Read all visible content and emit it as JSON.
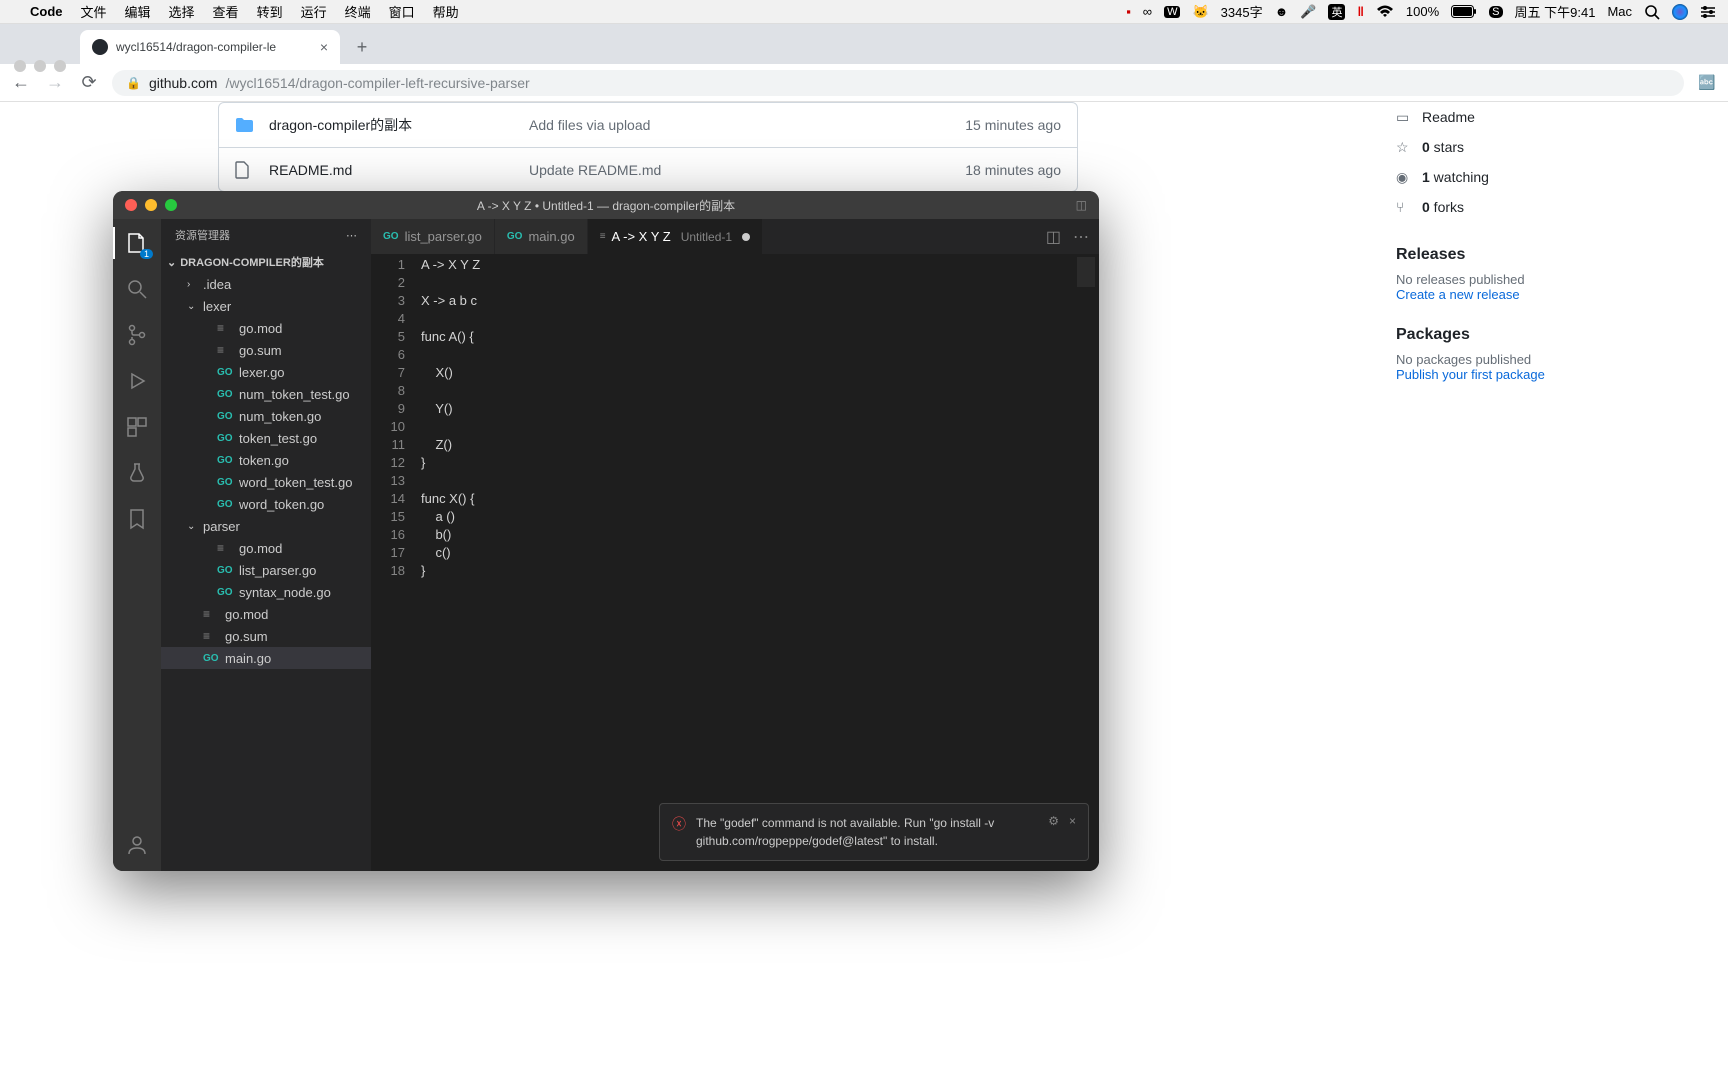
{
  "menubar": {
    "app": "Code",
    "items": [
      "文件",
      "编辑",
      "选择",
      "查看",
      "转到",
      "运行",
      "终端",
      "窗口",
      "帮助"
    ],
    "right": {
      "word_count": "3345字",
      "ime": "英",
      "battery": "100%",
      "clock": "周五 下午9:41",
      "user": "Mac"
    }
  },
  "chrome": {
    "tab_title": "wycl16514/dragon-compiler-le",
    "url_host": "github.com",
    "url_path": "/wycl16514/dragon-compiler-left-recursive-parser"
  },
  "github": {
    "files": [
      {
        "icon": "folder",
        "name": "dragon-compiler的副本",
        "msg": "Add files via upload",
        "time": "15 minutes ago"
      },
      {
        "icon": "file",
        "name": "README.md",
        "msg": "Update README.md",
        "time": "18 minutes ago"
      }
    ],
    "side": {
      "readme": "Readme",
      "stars": "0 stars",
      "watching": "1 watching",
      "forks": "0 forks",
      "releases_h": "Releases",
      "releases_txt": "No releases published",
      "releases_link": "Create a new release",
      "packages_h": "Packages",
      "packages_txt": "No packages published",
      "packages_link": "Publish your first package"
    }
  },
  "vscode": {
    "title": "A -> X Y Z • Untitled-1 — dragon-compiler的副本",
    "explorer_label": "资源管理器",
    "root": "DRAGON-COMPILER的副本",
    "activity_badge": "1",
    "tree": [
      {
        "type": "folder",
        "name": ".idea",
        "depth": 1,
        "open": false
      },
      {
        "type": "folder",
        "name": "lexer",
        "depth": 1,
        "open": true
      },
      {
        "type": "file",
        "name": "go.mod",
        "depth": 2,
        "kind": "mod"
      },
      {
        "type": "file",
        "name": "go.sum",
        "depth": 2,
        "kind": "mod"
      },
      {
        "type": "file",
        "name": "lexer.go",
        "depth": 2,
        "kind": "go"
      },
      {
        "type": "file",
        "name": "num_token_test.go",
        "depth": 2,
        "kind": "go"
      },
      {
        "type": "file",
        "name": "num_token.go",
        "depth": 2,
        "kind": "go"
      },
      {
        "type": "file",
        "name": "token_test.go",
        "depth": 2,
        "kind": "go"
      },
      {
        "type": "file",
        "name": "token.go",
        "depth": 2,
        "kind": "go"
      },
      {
        "type": "file",
        "name": "word_token_test.go",
        "depth": 2,
        "kind": "go"
      },
      {
        "type": "file",
        "name": "word_token.go",
        "depth": 2,
        "kind": "go"
      },
      {
        "type": "folder",
        "name": "parser",
        "depth": 1,
        "open": true
      },
      {
        "type": "file",
        "name": "go.mod",
        "depth": 2,
        "kind": "mod"
      },
      {
        "type": "file",
        "name": "list_parser.go",
        "depth": 2,
        "kind": "go"
      },
      {
        "type": "file",
        "name": "syntax_node.go",
        "depth": 2,
        "kind": "go"
      },
      {
        "type": "file",
        "name": "go.mod",
        "depth": 1,
        "kind": "mod"
      },
      {
        "type": "file",
        "name": "go.sum",
        "depth": 1,
        "kind": "mod"
      },
      {
        "type": "file",
        "name": "main.go",
        "depth": 1,
        "kind": "go",
        "selected": true
      }
    ],
    "tabs": [
      {
        "icon": "go",
        "label": "list_parser.go"
      },
      {
        "icon": "go",
        "label": "main.go"
      },
      {
        "icon": "txt",
        "label": "A -> X Y Z",
        "sub": "Untitled-1",
        "dirty": true,
        "active": true
      }
    ],
    "code_lines": [
      "A -> X Y Z",
      "",
      "X -> a b c",
      "",
      "func A() {",
      "",
      "    X()",
      "",
      "    Y()",
      "",
      "    Z()",
      "}",
      "",
      "func X() {",
      "    a ()",
      "    b()",
      "    c()",
      "}"
    ],
    "toast": "The \"godef\" command is not available. Run \"go install -v github.com/rogpeppe/godef@latest\" to install."
  }
}
